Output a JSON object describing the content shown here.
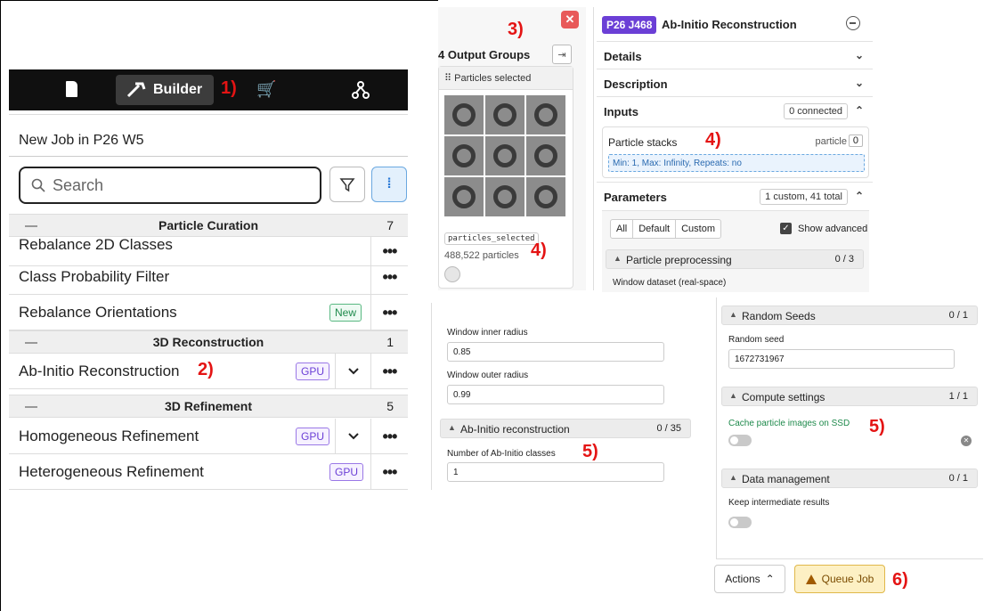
{
  "markers": {
    "m1": "1)",
    "m2": "2)",
    "m3": "3)",
    "m4a": "4)",
    "m4b": "4)",
    "m5a": "5)",
    "m5b": "5)",
    "m6": "6)"
  },
  "topbar": {
    "builder_label": "Builder",
    "icons": [
      "document-icon",
      "hammer-icon",
      "cart-icon",
      "workflow-tree-icon"
    ]
  },
  "builder": {
    "title": "New Job in P26 W5",
    "search_placeholder": "Search",
    "categories": [
      {
        "label": "Particle Curation",
        "count": "7"
      },
      {
        "label": "3D Reconstruction",
        "count": "1"
      },
      {
        "label": "3D Refinement",
        "count": "5"
      }
    ],
    "jobs": [
      {
        "label": "Rebalance 2D Classes"
      },
      {
        "label": "Class Probability Filter"
      },
      {
        "label": "Rebalance Orientations",
        "badge": "New"
      },
      {
        "label": "Ab-Initio Reconstruction",
        "badge": "GPU"
      },
      {
        "label": "Homogeneous Refinement",
        "badge": "GPU"
      },
      {
        "label": "Heterogeneous Refinement",
        "badge": "GPU"
      }
    ],
    "dots": "•••"
  },
  "outputs": {
    "title": "4 Output Groups",
    "card_header": "⠿ Particles selected",
    "code": "particles_selected",
    "count": "488,522 particles",
    "close": "✕"
  },
  "job": {
    "id": "P26 J468",
    "title": "Ab-Initio Reconstruction",
    "sections": {
      "details": "Details",
      "description": "Description",
      "inputs": "Inputs",
      "inputs_pill": "0 connected",
      "parameters": "Parameters",
      "parameters_pill": "1 custom, 41 total"
    },
    "particle_stacks": {
      "label": "Particle stacks",
      "type": "particle",
      "n": "0",
      "requirements": "Min: 1, Max: Infinity, Repeats: no"
    },
    "tabs": [
      "All",
      "Default",
      "Custom"
    ],
    "show_advanced": "Show advanced",
    "preprocessing": {
      "label": "Particle preprocessing",
      "count": "0 / 3"
    },
    "window_dataset": "Window dataset (real-space)"
  },
  "mid_params": {
    "inner_radius_label": "Window inner radius",
    "inner_radius_value": "0.85",
    "outer_radius_label": "Window outer radius",
    "outer_radius_value": "0.99",
    "abinitio_section": {
      "label": "Ab-Initio reconstruction",
      "count": "0 / 35"
    },
    "num_classes_label": "Number of Ab-Initio classes",
    "num_classes_value": "1"
  },
  "right_params": {
    "random_seeds": {
      "label": "Random Seeds",
      "count": "0 / 1"
    },
    "random_seed_label": "Random seed",
    "random_seed_value": "1672731967",
    "compute": {
      "label": "Compute settings",
      "count": "1 / 1"
    },
    "cache_label": "Cache particle images on SSD",
    "data_mgmt": {
      "label": "Data management",
      "count": "0 / 1"
    },
    "keep_label": "Keep intermediate results"
  },
  "footer": {
    "actions": "Actions",
    "queue": "Queue Job"
  },
  "colors": {
    "marker_red": "#e41414",
    "gpu_purple": "#6b3fd6",
    "new_green": "#1f8a4c",
    "queue_yellow": "#fdf0c4"
  }
}
